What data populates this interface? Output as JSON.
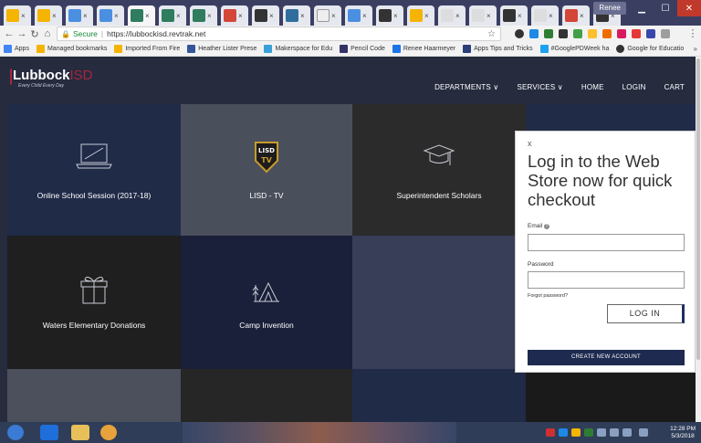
{
  "browser": {
    "profile_name": "Renee",
    "url_secure": "Secure",
    "url": "https://lubbockisd.revtrak.net"
  },
  "bookmarks": [
    {
      "label": "Apps",
      "color": "#4285f4"
    },
    {
      "label": "Managed bookmarks",
      "color": "#f4b400"
    },
    {
      "label": "Imported From Fire",
      "color": "#f4b400"
    },
    {
      "label": "Heather Lister Prese",
      "color": "#335599"
    },
    {
      "label": "Makerspace for Edu",
      "color": "#3aa0d8"
    },
    {
      "label": "Pencil Code",
      "color": "#333366"
    },
    {
      "label": "Renee Haarmeyer",
      "color": "#1a73e8"
    },
    {
      "label": "Apps Tips and Tricks",
      "color": "#2c3e7a"
    },
    {
      "label": "#GooglePDWeek ha",
      "color": "#1da1f2"
    },
    {
      "label": "Google for Educatio",
      "color": "#333"
    }
  ],
  "site": {
    "logo_name": "Lubbock",
    "logo_suffix": "ISD",
    "logo_tagline": "Every Child Every Day",
    "nav": {
      "departments": "DEPARTMENTS ∨",
      "services": "SERVICES ∨",
      "home": "HOME",
      "login": "LOGIN",
      "cart": "CART"
    },
    "tiles": {
      "online_school": "Online School Session (2017-18)",
      "lisd_tv": "LISD - TV",
      "superintendent": "Superintendent Scholars",
      "waters": "Waters Elementary Donations",
      "camp": "Camp Invention"
    },
    "lisd_badge": "LISD",
    "lisd_badge_tv": "TV"
  },
  "modal": {
    "close": "x",
    "title": "Log in to the Web Store now for quick checkout",
    "email_label": "Email",
    "password_label": "Password",
    "forgot": "Forgot password?",
    "login_button": "LOG IN",
    "create_button": "CREATE NEW ACCOUNT"
  },
  "taskbar": {
    "time": "12:28 PM",
    "date": "5/3/2018"
  }
}
